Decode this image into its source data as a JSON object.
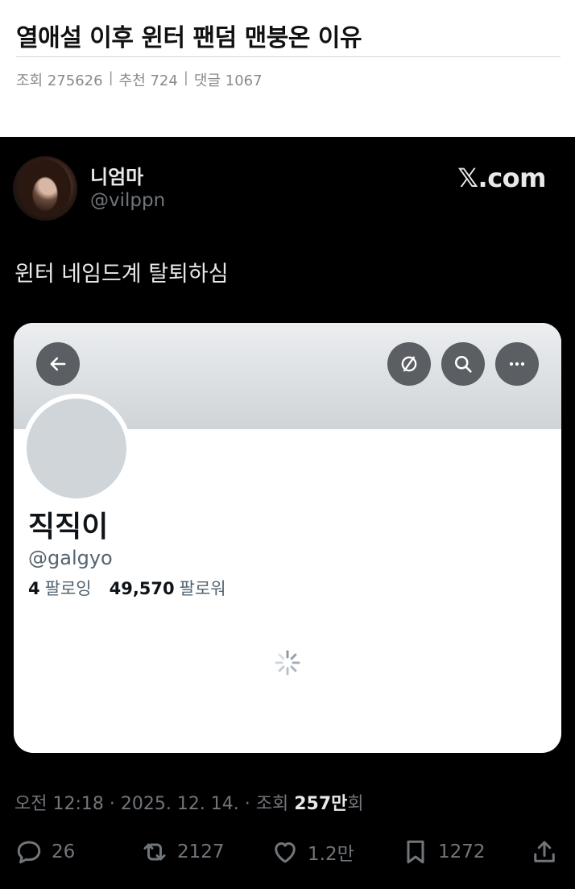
{
  "post": {
    "title": "열애설 이후 윈터 팬덤 맨붕온 이유",
    "views": "조회 275626",
    "recommends": "추천 724",
    "comments": "댓글 1067",
    "separator": "|"
  },
  "tweet": {
    "display_name": "니엄마",
    "handle": "@vilppn",
    "brand": "𝕏.com",
    "text": "윈터 네임드계 탈퇴하심",
    "meta_time": "오전 12:18 · 2025. 12. 14. · 조회 ",
    "meta_views_value": "257만",
    "meta_views_suffix": "회",
    "actions": {
      "replies": "26",
      "reposts": "2127",
      "likes": "1.2만",
      "bookmarks": "1272"
    }
  },
  "embedded_profile": {
    "name": "직직이",
    "handle": "@galgyo",
    "following_count": "4",
    "following_label": "팔로잉",
    "followers_count": "49,570",
    "followers_label": "팔로워"
  },
  "icons": [
    "back-arrow-icon",
    "hide-icon",
    "search-icon",
    "more-icon",
    "loading-spinner-icon",
    "reply-icon",
    "repost-icon",
    "like-icon",
    "bookmark-icon",
    "share-icon"
  ],
  "colors": {
    "background": "#000000",
    "text_primary": "#e7e9ea",
    "text_secondary": "#71767b"
  }
}
